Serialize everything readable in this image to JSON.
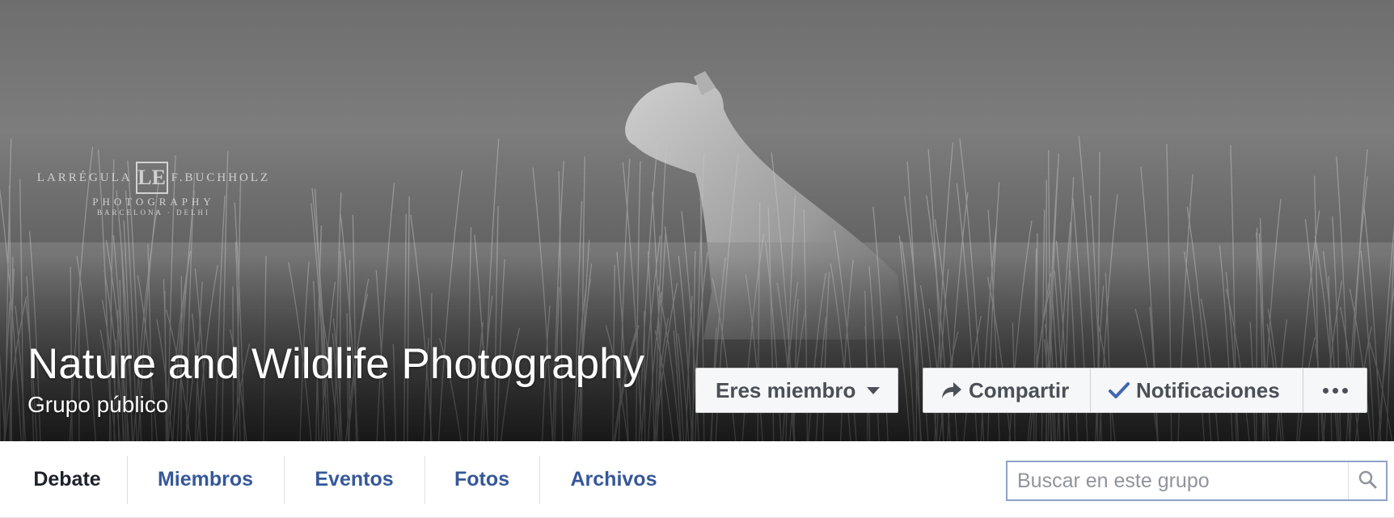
{
  "cover": {
    "watermark": {
      "left_name": "LARRÉGULA",
      "logo": "LE",
      "right_name": "F.BUCHHOLZ",
      "sub": "PHOTOGRAPHY",
      "location": "BARCELONA · DELHI"
    },
    "image_subject": "lioness-in-grass-bw",
    "title": "Nature and Wildlife Photography",
    "privacy": "Grupo público"
  },
  "actions": {
    "member_label": "Eres miembro",
    "share_label": "Compartir",
    "notifications_label": "Notificaciones",
    "more_icon": "ellipsis-icon"
  },
  "tabs": [
    {
      "label": "Debate",
      "active": true
    },
    {
      "label": "Miembros",
      "active": false
    },
    {
      "label": "Eventos",
      "active": false
    },
    {
      "label": "Fotos",
      "active": false
    },
    {
      "label": "Archivos",
      "active": false
    }
  ],
  "search": {
    "placeholder": "Buscar en este grupo",
    "value": ""
  },
  "colors": {
    "link": "#365899",
    "active_tab": "#1d2129",
    "check": "#4267b2",
    "button_text": "#4b4f56"
  }
}
